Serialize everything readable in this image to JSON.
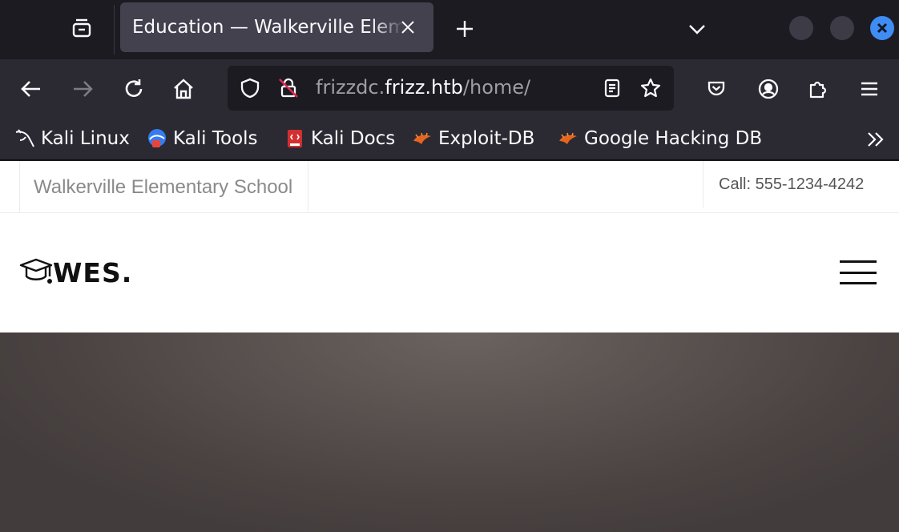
{
  "browser": {
    "tab": {
      "title": "Education — Walkerville Elementary School"
    },
    "url": {
      "prefix": "frizzdc.",
      "domain": "frizz.htb",
      "path": "/home/"
    },
    "bookmarks": [
      {
        "label": "Kali Linux",
        "icon": "kali-dragon-icon"
      },
      {
        "label": "Kali Tools",
        "icon": "kali-tools-icon"
      },
      {
        "label": "Kali Docs",
        "icon": "kali-docs-icon"
      },
      {
        "label": "Exploit-DB",
        "icon": "exploit-db-icon"
      },
      {
        "label": "Google Hacking DB",
        "icon": "ghdb-icon"
      }
    ],
    "colors": {
      "close_button": "#3f8cf3",
      "tab_active": "#42414d",
      "toolbar": "#2b2a33"
    }
  },
  "site": {
    "topbar": {
      "school_name": "Walkerville Elementary School",
      "phone": "Call: 555-1234-4242"
    },
    "logo": {
      "text": "WES.",
      "icon": "graduation-cap-icon"
    }
  }
}
